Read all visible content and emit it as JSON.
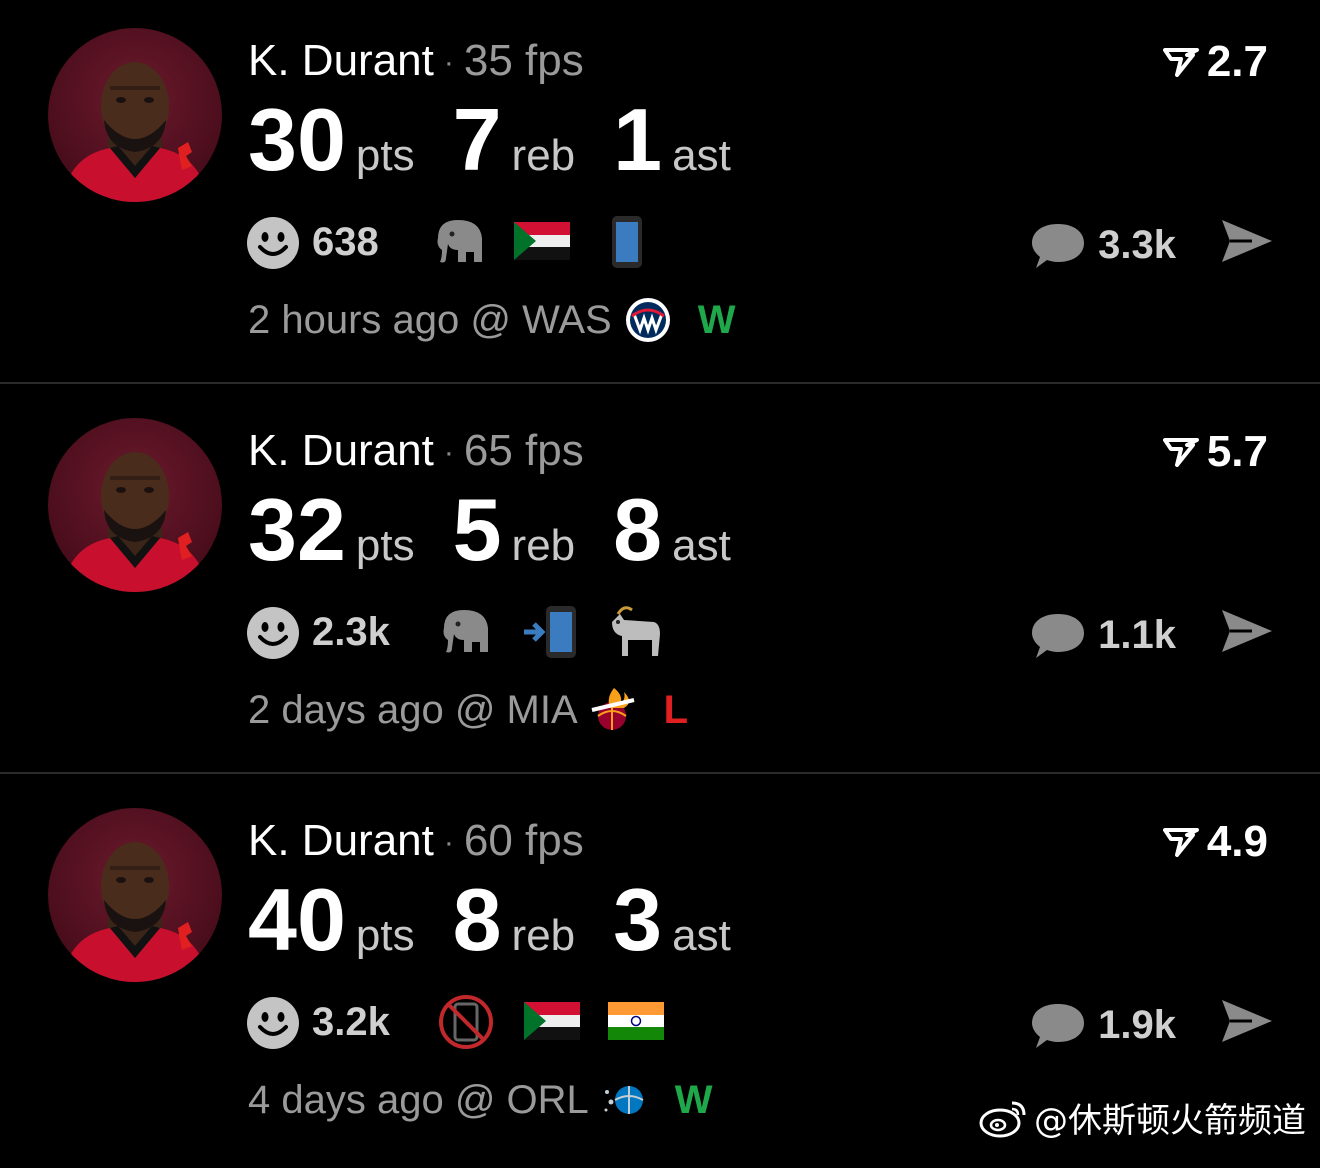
{
  "posts": [
    {
      "player": "K. Durant",
      "fps": "35 fps",
      "rating": "2.7",
      "pts": "30",
      "pts_label": "pts",
      "reb": "7",
      "reb_label": "reb",
      "ast": "1",
      "ast_label": "ast",
      "reactions": "638",
      "reaction_emojis": [
        "elephant-emoji",
        "sudan-flag-emoji",
        "mobile-phone-emoji"
      ],
      "comments": "3.3k",
      "time": "2 hours ago @ WAS",
      "team_logo": "wizards-logo",
      "result": "W",
      "result_color": "#1fa84a"
    },
    {
      "player": "K. Durant",
      "fps": "65 fps",
      "rating": "5.7",
      "pts": "32",
      "pts_label": "pts",
      "reb": "5",
      "reb_label": "reb",
      "ast": "8",
      "ast_label": "ast",
      "reactions": "2.3k",
      "reaction_emojis": [
        "elephant-emoji",
        "phone-with-arrow-emoji",
        "goat-emoji"
      ],
      "comments": "1.1k",
      "time": "2 days ago @ MIA",
      "team_logo": "heat-logo",
      "result": "L",
      "result_color": "#e02020"
    },
    {
      "player": "K. Durant",
      "fps": "60 fps",
      "rating": "4.9",
      "pts": "40",
      "pts_label": "pts",
      "reb": "8",
      "reb_label": "reb",
      "ast": "3",
      "ast_label": "ast",
      "reactions": "3.2k",
      "reaction_emojis": [
        "no-mobile-phones-emoji",
        "sudan-flag-emoji",
        "india-flag-emoji"
      ],
      "comments": "1.9k",
      "time": "4 days ago @ ORL",
      "team_logo": "magic-logo",
      "result": "W",
      "result_color": "#1fa84a"
    }
  ],
  "watermark": "@休斯顿火箭频道",
  "colors": {
    "background": "#000000",
    "muted": "#9a9a9a",
    "win": "#1fa84a",
    "loss": "#e02020"
  }
}
